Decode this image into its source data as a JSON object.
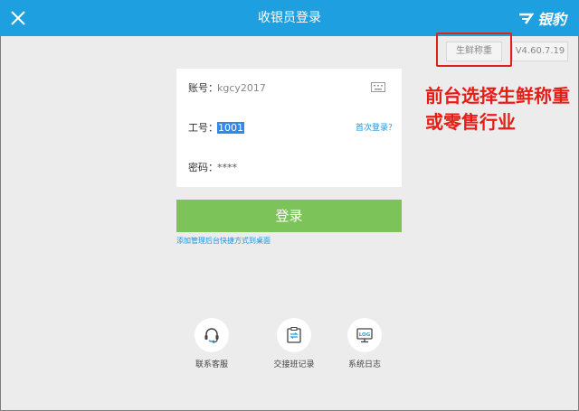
{
  "header": {
    "title": "收银员登录",
    "brand": "银豹",
    "bg_color": "#1d9fe0"
  },
  "top_right": {
    "mode_label": "生鲜称重",
    "version": "V4.60.7.19"
  },
  "annotation": {
    "text_line1": "前台选择生鲜称重",
    "text_line2": "或零售行业",
    "color": "#e51d16"
  },
  "form": {
    "account_label": "账号：",
    "account_value": "kgcy2017",
    "employee_label": "工号：",
    "employee_value": "1001",
    "first_login_link": "首次登录？",
    "password_label": "密码：",
    "password_value": "****"
  },
  "login_button": {
    "label": "登录",
    "color": "#7cc45a"
  },
  "shortcut_link": "添加管理后台快捷方式到桌面",
  "tools": [
    {
      "icon": "headset-icon",
      "label": "联系客服"
    },
    {
      "icon": "shift-record-icon",
      "label": "交接班记录"
    },
    {
      "icon": "log-icon",
      "label": "系统日志",
      "icon_text": "LOG"
    }
  ]
}
